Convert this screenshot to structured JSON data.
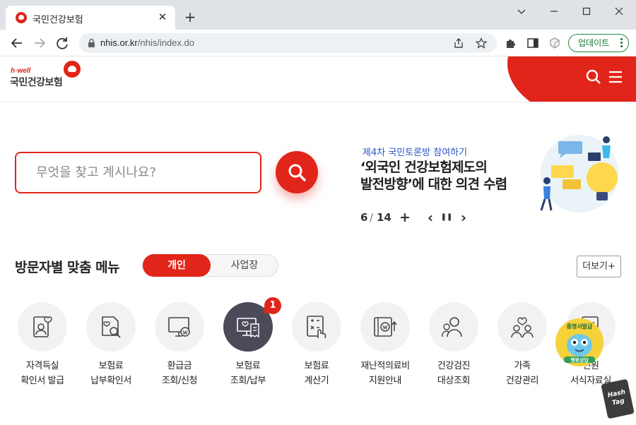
{
  "browser": {
    "tab_title": "국민건강보험",
    "url_host": "nhis.or.kr",
    "url_path": "/nhis/index.do",
    "update_label": "업데이트"
  },
  "site": {
    "logo_tagline": "h·well",
    "logo_name": "국민건강보험",
    "brand_color": "#e1251b"
  },
  "search": {
    "placeholder": "무엇을 찾고 계시나요?"
  },
  "banner": {
    "subtitle": "제4차 국민토론방 참여하기",
    "title_line1": "‘외국인 건강보험제도의",
    "title_line2": "발전방향’에 대한 의견 수렴",
    "counter_current": "6",
    "counter_sep": "/",
    "counter_total": "14",
    "add": "+",
    "prev": "‹",
    "pause": "❚❚",
    "next": "›"
  },
  "visitor_menu": {
    "title": "방문자별 맞춤 메뉴",
    "tab_personal": "개인",
    "tab_business": "사업장",
    "more": "더보기+",
    "badge_count": "1",
    "items": [
      {
        "line1": "자격득실",
        "line2": "확인서 발급",
        "icon": "id-card-heart-icon"
      },
      {
        "line1": "보험료",
        "line2": "납부확인서",
        "icon": "document-search-icon"
      },
      {
        "line1": "환급금",
        "line2": "조회/신청",
        "icon": "monitor-refund-icon"
      },
      {
        "line1": "보험료",
        "line2": "조회/납부",
        "icon": "monitor-receipt-icon"
      },
      {
        "line1": "보험료",
        "line2": "계산기",
        "icon": "calculator-icon"
      },
      {
        "line1": "재난적의료비",
        "line2": "지원안내",
        "icon": "coin-support-icon"
      },
      {
        "line1": "건강검진",
        "line2": "대상조회",
        "icon": "people-checkup-icon"
      },
      {
        "line1": "가족",
        "line2": "건강관리",
        "icon": "family-care-icon"
      },
      {
        "line1": "민원",
        "line2": "서식자료실",
        "icon": "form-folder-icon"
      }
    ]
  },
  "mascot": {
    "top_text": "증명서발급",
    "bottom_text": "챗봇상담"
  },
  "watermark": {
    "line1": "Hash",
    "line2": "Tag"
  }
}
